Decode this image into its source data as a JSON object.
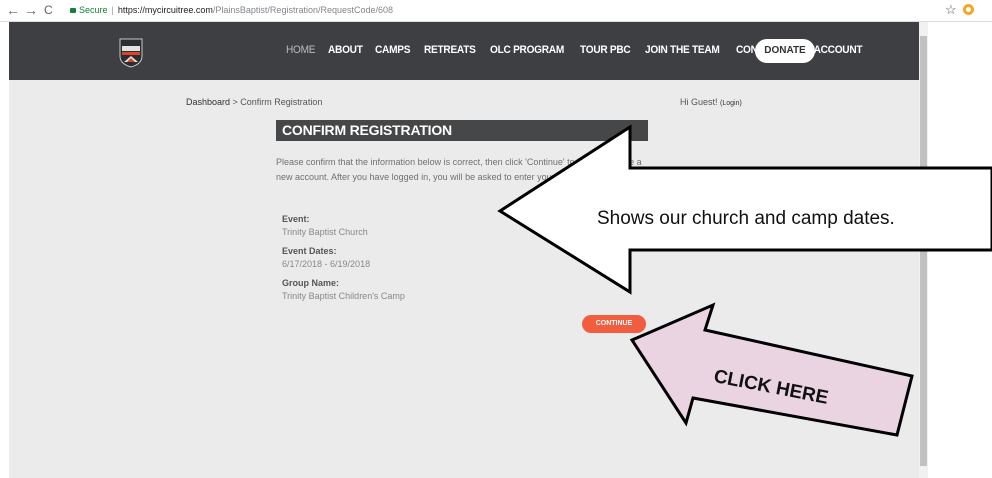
{
  "browser": {
    "back": "←",
    "forward": "→",
    "reload": "C",
    "secure_label": "Secure",
    "url_domain": "https://mycircuitree.com",
    "url_path": "/PlainsBaptist/Registration/RequestCode/608",
    "star": "☆"
  },
  "header": {
    "logo_text": "PLAINS BAPTIST",
    "menu": [
      {
        "label": "HOME",
        "active": true
      },
      {
        "label": "ABOUT"
      },
      {
        "label": "CAMPS"
      },
      {
        "label": "RETREATS"
      },
      {
        "label": "OLC PROGRAM"
      },
      {
        "label": "TOUR PBC"
      },
      {
        "label": "JOIN THE TEAM"
      },
      {
        "label": "CONTACT"
      },
      {
        "label": "MY ACCOUNT"
      }
    ],
    "donate_label": "DONATE"
  },
  "breadcrumb": {
    "dashboard": "Dashboard",
    "separator": " > ",
    "current": "Confirm Registration"
  },
  "greeting": {
    "text": "Hi Guest! ",
    "login": "(Login)"
  },
  "main": {
    "title": "CONFIRM REGISTRATION",
    "instructions": "Please confirm that the information below is correct, then click 'Continue' to login or create a new account. After you have logged in, you will be asked to enter your registration information.",
    "fields": [
      {
        "label": "Event:",
        "value": "Trinity Baptist Church"
      },
      {
        "label": "Event Dates:",
        "value": "6/17/2018 - 6/19/2018"
      },
      {
        "label": "Group Name:",
        "value": "Trinity Baptist Children's Camp"
      }
    ],
    "continue_label": "CONTINUE"
  },
  "annotations": {
    "callout": "Shows our church and camp dates.",
    "click_here": "CLICK HERE",
    "click_arrow_color": "#ead4e1"
  },
  "colors": {
    "header_bg": "#3d3f42",
    "content_bg": "#ebebeb",
    "accent": "#f05d3f"
  }
}
